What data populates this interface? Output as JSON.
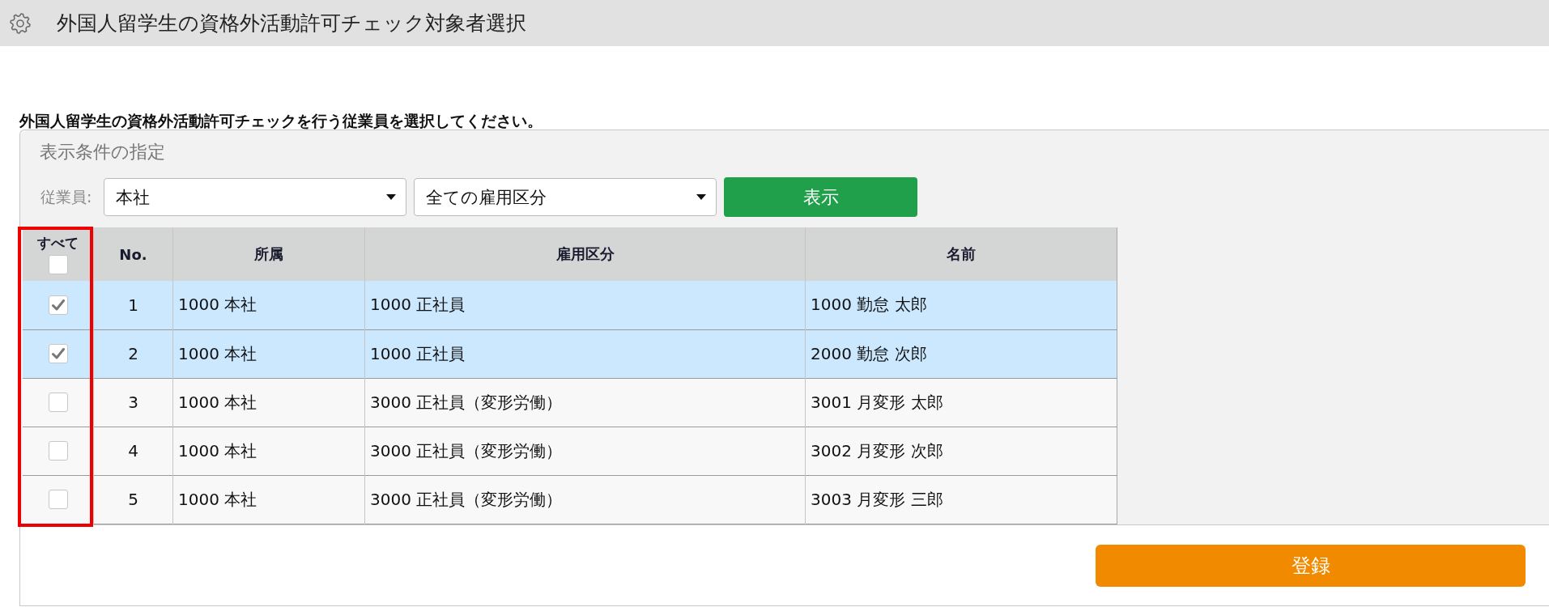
{
  "title_bar": {
    "title": "外国人留学生の資格外活動許可チェック対象者選択"
  },
  "instruction": "外国人留学生の資格外活動許可チェックを行う従業員を選択してください。",
  "filter_panel": {
    "title": "表示条件の指定",
    "employee_label": "従業員:",
    "dropdowns": [
      {
        "value": "本社"
      },
      {
        "value": "全ての雇用区分"
      }
    ],
    "show_button": "表示"
  },
  "table": {
    "select_all": {
      "label": "すべて",
      "checked": false
    },
    "columns": [
      "No.",
      "所属",
      "雇用区分",
      "名前"
    ],
    "rows": [
      {
        "selected": true,
        "checked": true,
        "cells": [
          "1",
          "1000 本社",
          "1000 正社員",
          "1000 勤怠 太郎"
        ]
      },
      {
        "selected": true,
        "checked": true,
        "cells": [
          "2",
          "1000 本社",
          "1000 正社員",
          "2000 勤怠 次郎"
        ]
      },
      {
        "selected": false,
        "checked": false,
        "cells": [
          "3",
          "1000 本社",
          "3000 正社員（変形労働）",
          "3001 月変形 太郎"
        ]
      },
      {
        "selected": false,
        "checked": false,
        "cells": [
          "4",
          "1000 本社",
          "3000 正社員（変形労働）",
          "3002 月変形 次郎"
        ]
      },
      {
        "selected": false,
        "checked": false,
        "cells": [
          "5",
          "1000 本社",
          "3000 正社員（変形労働）",
          "3003 月変形 三郎"
        ]
      }
    ]
  },
  "register_button": "登録"
}
